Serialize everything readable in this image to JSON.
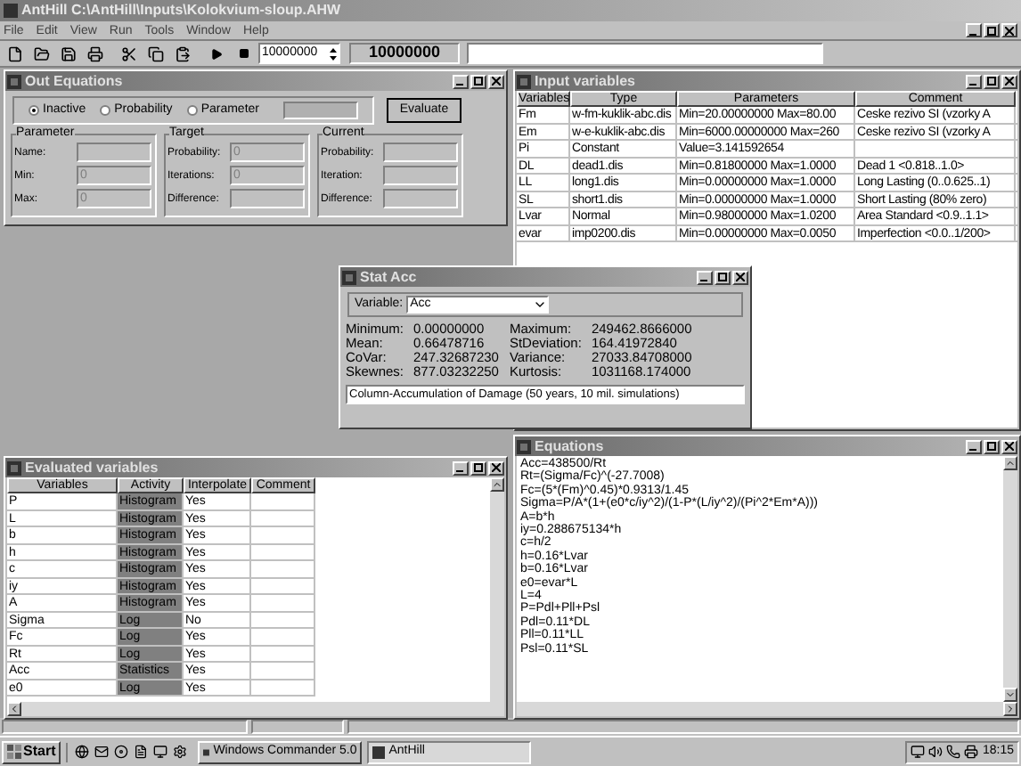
{
  "window": {
    "title": "AntHill C:\\AntHill\\Inputs\\Kolokvium-sloup.AHW"
  },
  "menu": [
    "File",
    "Edit",
    "View",
    "Run",
    "Tools",
    "Window",
    "Help"
  ],
  "toolbar": {
    "iterations": "10000000",
    "counter": "10000000"
  },
  "out_equations": {
    "title": "Out Equations",
    "modes": [
      {
        "label": "Inactive",
        "selected": true
      },
      {
        "label": "Probability",
        "selected": false
      },
      {
        "label": "Parameter",
        "selected": false
      }
    ],
    "evaluate": "Evaluate",
    "groups": [
      {
        "title": "Parameter",
        "fields": [
          {
            "label": "Name:",
            "disabled": true
          },
          {
            "label": "Min:",
            "value": "0",
            "disabled": true
          },
          {
            "label": "Max:",
            "value": "0",
            "disabled": true
          }
        ]
      },
      {
        "title": "Target",
        "fields": [
          {
            "label": "Probability:",
            "value": "0",
            "disabled": true
          },
          {
            "label": "Iterations:",
            "value": "0",
            "disabled": true
          },
          {
            "label": "Difference:",
            "disabled": true
          }
        ]
      },
      {
        "title": "Current",
        "fields": [
          {
            "label": "Probability:",
            "disabled": true
          },
          {
            "label": "Iteration:",
            "disabled": true
          },
          {
            "label": "Difference:",
            "disabled": true
          }
        ]
      }
    ]
  },
  "input_variables": {
    "title": "Input variables",
    "columns": [
      "Variables",
      "Type",
      "Parameters",
      "Comment"
    ],
    "rows": [
      {
        "variable": "Fm",
        "type": "w-fm-kuklik-abc.dis",
        "parameters": "Min=20.00000000 Max=80.00",
        "comment": "Ceske rezivo SI (vzorky A"
      },
      {
        "variable": "Em",
        "type": "w-e-kuklik-abc.dis",
        "parameters": "Min=6000.00000000 Max=260",
        "comment": "Ceske rezivo SI (vzorky A"
      },
      {
        "variable": "Pi",
        "type": "Constant",
        "parameters": "Value=3.141592654"
      },
      {
        "variable": "DL",
        "type": "dead1.dis",
        "parameters": "Min=0.81800000 Max=1.0000",
        "comment": "Dead 1  <0.818..1.0>"
      },
      {
        "variable": "LL",
        "type": "long1.dis",
        "parameters": "Min=0.00000000 Max=1.0000",
        "comment": "Long Lasting (0..0.625..1)"
      },
      {
        "variable": "SL",
        "type": "short1.dis",
        "parameters": "Min=0.00000000 Max=1.0000",
        "comment": "Short Lasting (80% zero)"
      },
      {
        "variable": "Lvar",
        "type": "Normal",
        "parameters": "Min=0.98000000 Max=1.0200",
        "comment": "Area Standard <0.9..1.1>"
      },
      {
        "variable": "evar",
        "type": "imp0200.dis",
        "parameters": "Min=0.00000000 Max=0.0050",
        "comment": "Imperfection <0.0..1/200>"
      }
    ]
  },
  "stat_acc": {
    "title": "Stat Acc",
    "variable_label": "Variable:",
    "variable": "Acc",
    "left": [
      {
        "label": "Minimum:",
        "value": "0.00000000"
      },
      {
        "label": "Mean:",
        "value": "0.66478716"
      },
      {
        "label": "CoVar:",
        "value": "247.32687230"
      },
      {
        "label": "Skewnes:",
        "value": "877.03232250"
      }
    ],
    "right": [
      {
        "label": "Maximum:",
        "value": "249462.8666000"
      },
      {
        "label": "StDeviation:",
        "value": "164.41972840"
      },
      {
        "label": "Variance:",
        "value": "27033.84708000"
      },
      {
        "label": "Kurtosis:",
        "value": "1031168.174000"
      }
    ],
    "description": "Column-Accumulation of Damage (50 years, 10 mil. simulations)"
  },
  "evaluated_variables": {
    "title": "Evaluated variables",
    "columns": [
      "Variables",
      "Activity",
      "Interpolate",
      "Comment"
    ],
    "rows": [
      {
        "variable": "P",
        "activity": "Histogram",
        "interpolate": "Yes"
      },
      {
        "variable": "L",
        "activity": "Histogram",
        "interpolate": "Yes"
      },
      {
        "variable": "b",
        "activity": "Histogram",
        "interpolate": "Yes"
      },
      {
        "variable": "h",
        "activity": "Histogram",
        "interpolate": "Yes"
      },
      {
        "variable": "c",
        "activity": "Histogram",
        "interpolate": "Yes"
      },
      {
        "variable": "iy",
        "activity": "Histogram",
        "interpolate": "Yes"
      },
      {
        "variable": "A",
        "activity": "Histogram",
        "interpolate": "Yes"
      },
      {
        "variable": "Sigma",
        "activity": "Log",
        "interpolate": "No"
      },
      {
        "variable": "Fc",
        "activity": "Log",
        "interpolate": "Yes"
      },
      {
        "variable": "Rt",
        "activity": "Log",
        "interpolate": "Yes"
      },
      {
        "variable": "Acc",
        "activity": "Statistics",
        "interpolate": "Yes"
      },
      {
        "variable": "e0",
        "activity": "Log",
        "interpolate": "Yes"
      }
    ]
  },
  "equations": {
    "title": "Equations",
    "lines": [
      "Acc=438500/Rt",
      "Rt=(Sigma/Fc)^(-27.7008)",
      "Fc=(5*(Fm)^0.45)*0.9313/1.45",
      "Sigma=P/A*(1+(e0*c/iy^2)/(1-P*(L/iy^2)/(Pi^2*Em*A)))",
      "A=b*h",
      "iy=0.288675134*h",
      "c=h/2",
      "h=0.16*Lvar",
      "b=0.16*Lvar",
      "e0=evar*L",
      "L=4",
      "P=Pdl+Pll+Psl",
      "Pdl=0.11*DL",
      "Pll=0.11*LL",
      "Psl=0.11*SL"
    ]
  },
  "taskbar": {
    "start": "Start",
    "tasks": [
      {
        "label": "Windows Commander 5.0",
        "selected": false
      },
      {
        "label": "AntHill",
        "selected": true
      }
    ],
    "clock": "18:15"
  }
}
